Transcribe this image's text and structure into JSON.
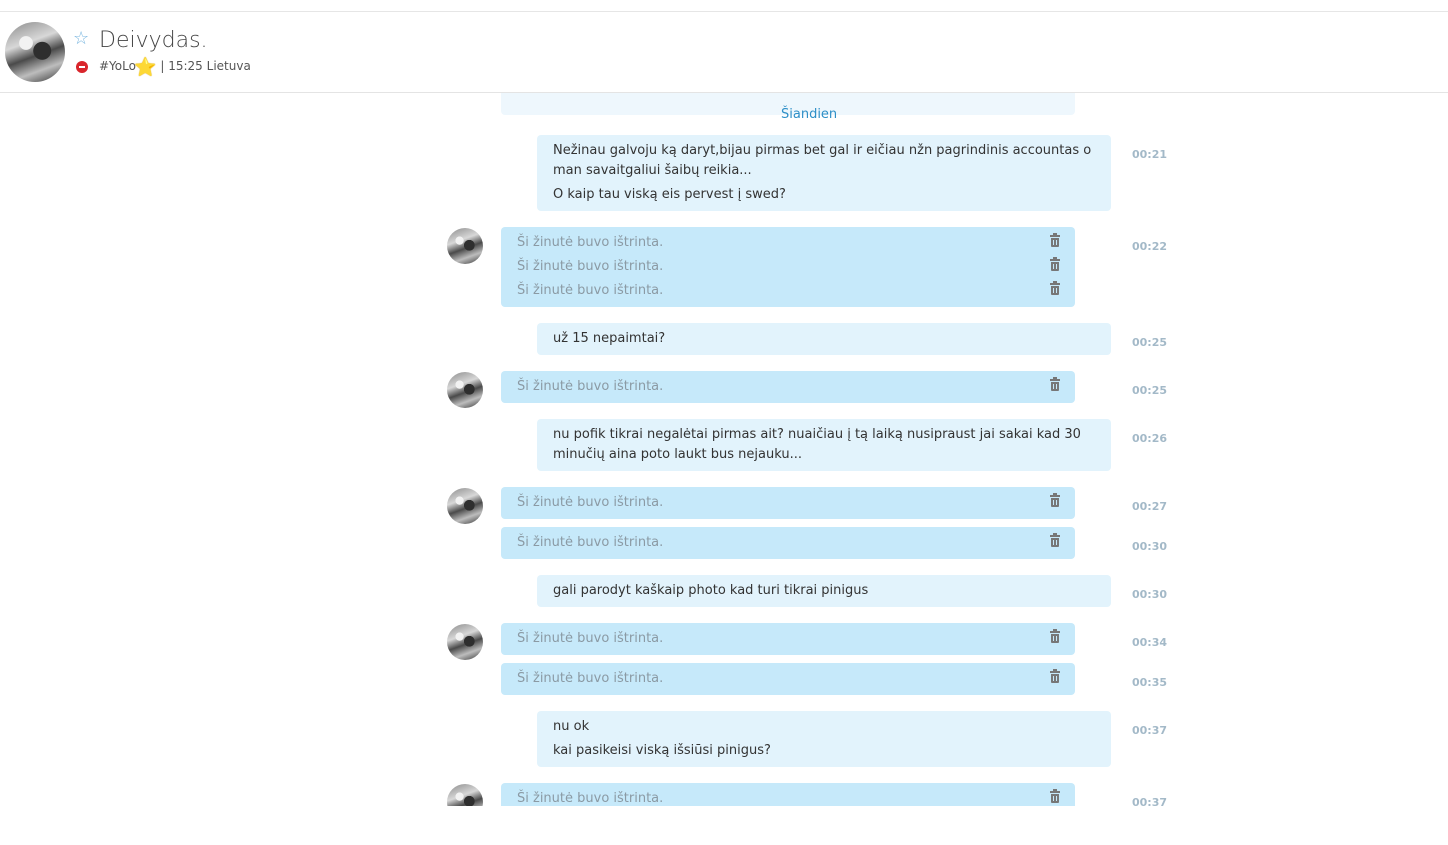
{
  "header": {
    "contact_name": "Deivydas.",
    "mood": "#YoLo",
    "mood_emoticon": "⭐",
    "status_info": "| 15:25 Lietuva",
    "favorite_icon": "star-outline-icon",
    "status_icon": "do-not-disturb-icon"
  },
  "chat": {
    "date_separator": "Šiandien",
    "deleted_text": "Ši žinutė buvo ištrinta.",
    "messages": [
      {
        "dir": "out",
        "time": "00:21",
        "lines": [
          "Nežinau galvoju ką daryt,bijau pirmas bet gal ir eičiau nžn pagrindinis accountas o man savaitgaliui šaibų reikia...",
          "O kaip tau viską eis pervest į swed?"
        ]
      },
      {
        "dir": "in",
        "time": "00:22",
        "lines": [
          "Ši žinutė buvo ištrinta.",
          "Ši žinutė buvo ištrinta.",
          "Ši žinutė buvo ištrinta."
        ]
      },
      {
        "dir": "out",
        "time": "00:25",
        "lines": [
          "už 15 nepaimtai?"
        ]
      },
      {
        "dir": "in",
        "time": "00:25",
        "lines": [
          "Ši žinutė buvo ištrinta."
        ]
      },
      {
        "dir": "out",
        "time": "00:26",
        "lines": [
          "nu pofik tikrai negalėtai pirmas ait? nuaičiau į tą laiką nusipraust jai sakai kad 30 minučių aina poto laukt bus nejauku..."
        ]
      },
      {
        "dir": "in",
        "time": "00:27",
        "lines": [
          "Ši žinutė buvo ištrinta."
        ]
      },
      {
        "dir": "in",
        "time": "00:30",
        "lines": [
          "Ši žinutė buvo ištrinta."
        ]
      },
      {
        "dir": "out",
        "time": "00:30",
        "lines": [
          "gali parodyt kaškaip photo kad turi tikrai pinigus"
        ]
      },
      {
        "dir": "in",
        "time": "00:34",
        "lines": [
          "Ši žinutė buvo ištrinta."
        ]
      },
      {
        "dir": "in",
        "time": "00:35",
        "lines": [
          "Ši žinutė buvo ištrinta."
        ]
      },
      {
        "dir": "out",
        "time": "00:37",
        "lines": [
          "nu ok",
          "kai pasikeisi viską išsiūsi pinigus?"
        ]
      },
      {
        "dir": "in",
        "time": "00:37",
        "lines": [
          "Ši žinutė buvo ištrinta."
        ]
      }
    ]
  },
  "colors": {
    "outgoing_bubble": "#e2f3fc",
    "incoming_bubble": "#c6e9fa",
    "accent": "#2e8fc7",
    "time_text": "#a3b9c8",
    "status_dnd": "#d9262c"
  }
}
